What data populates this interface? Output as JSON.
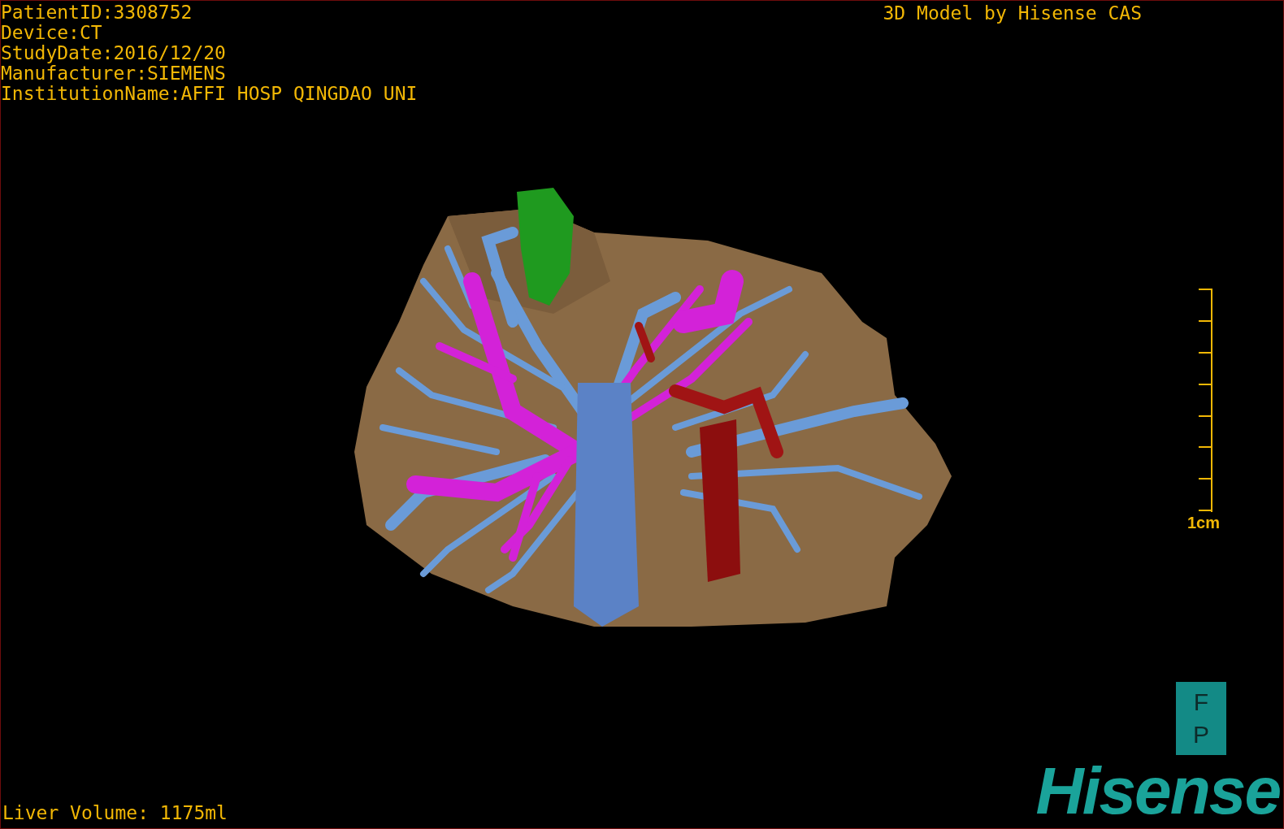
{
  "header": {
    "info_lines": [
      "PatientID:3308752",
      "Device:CT",
      "StudyDate:2016/12/20",
      "Manufacturer:SIEMENS",
      "InstitutionName:AFFI HOSP QINGDAO UNI"
    ],
    "title": "3D Model by Hisense CAS"
  },
  "scale_bar": {
    "label": "1cm"
  },
  "footer": {
    "volume": "Liver Volume: 1175ml",
    "orientation": [
      "F",
      "P"
    ],
    "logo": "Hisense"
  }
}
